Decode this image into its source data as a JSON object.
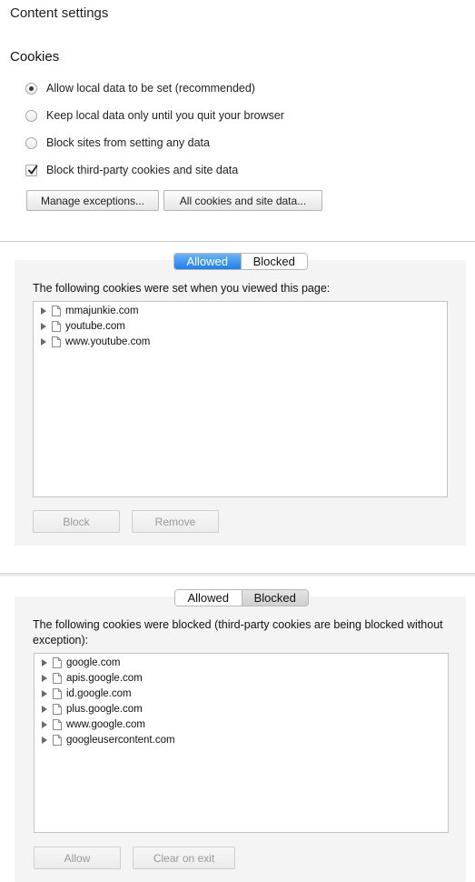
{
  "header": {
    "title": "Content settings"
  },
  "cookies": {
    "heading": "Cookies",
    "options": [
      {
        "label": "Allow local data to be set (recommended)",
        "selected": true
      },
      {
        "label": "Keep local data only until you quit your browser",
        "selected": false
      },
      {
        "label": "Block sites from setting any data",
        "selected": false
      }
    ],
    "third_party": {
      "label": "Block third-party cookies and site data",
      "checked": true
    },
    "manage_exceptions_label": "Manage exceptions...",
    "all_cookies_label": "All cookies and site data..."
  },
  "allowed_panel": {
    "tab_allowed": "Allowed",
    "tab_blocked": "Blocked",
    "active_tab": "Allowed",
    "description": "The following cookies were set when you viewed this page:",
    "items": [
      "mmajunkie.com",
      "youtube.com",
      "www.youtube.com"
    ],
    "block_label": "Block",
    "remove_label": "Remove"
  },
  "blocked_panel": {
    "tab_allowed": "Allowed",
    "tab_blocked": "Blocked",
    "active_tab": "Blocked",
    "description": "The following cookies were blocked (third-party cookies are being blocked without exception):",
    "items": [
      "google.com",
      "apis.google.com",
      "id.google.com",
      "plus.google.com",
      "www.google.com",
      "googleusercontent.com"
    ],
    "allow_label": "Allow",
    "clear_label": "Clear on exit"
  },
  "colors": {
    "accent": "#2e86ee",
    "panel_bg": "#f4f4f4"
  }
}
